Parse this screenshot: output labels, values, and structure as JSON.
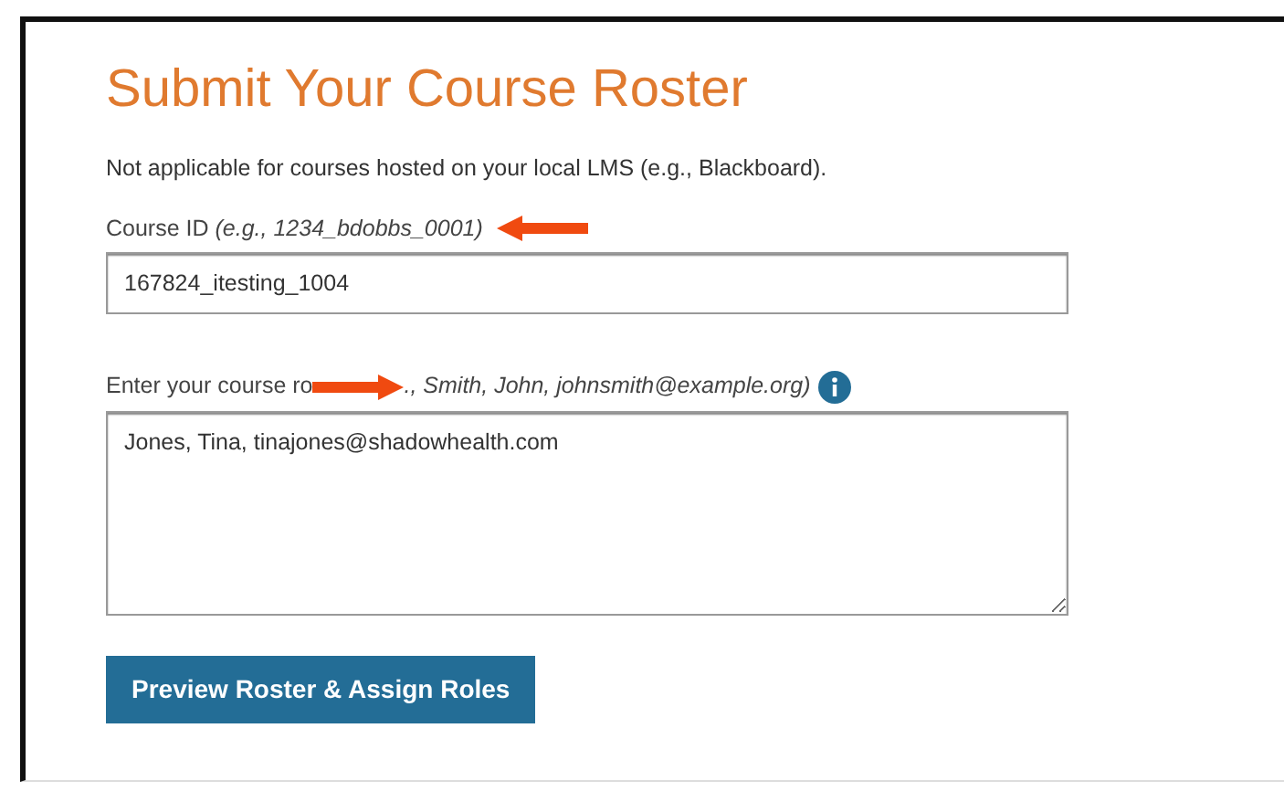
{
  "title": "Submit Your Course Roster",
  "note": "Not applicable for courses hosted on your local LMS (e.g., Blackboard).",
  "course_id": {
    "label": "Course ID *(e.g., 1234_bdobbs_0001)*",
    "value": "167824_itesting_1004",
    "annotation_arrow": {
      "kind": "left"
    }
  },
  "roster": {
    "label_start": "Enter your course ro",
    "label_end": "., Smith, John, johnsmith@example.org)",
    "annotation_arrow": {
      "kind": "right"
    },
    "value": "Jones, Tina, tinajones@shadowhealth.com"
  },
  "buttons": [
    "Preview Roster & Assign Roles"
  ]
}
